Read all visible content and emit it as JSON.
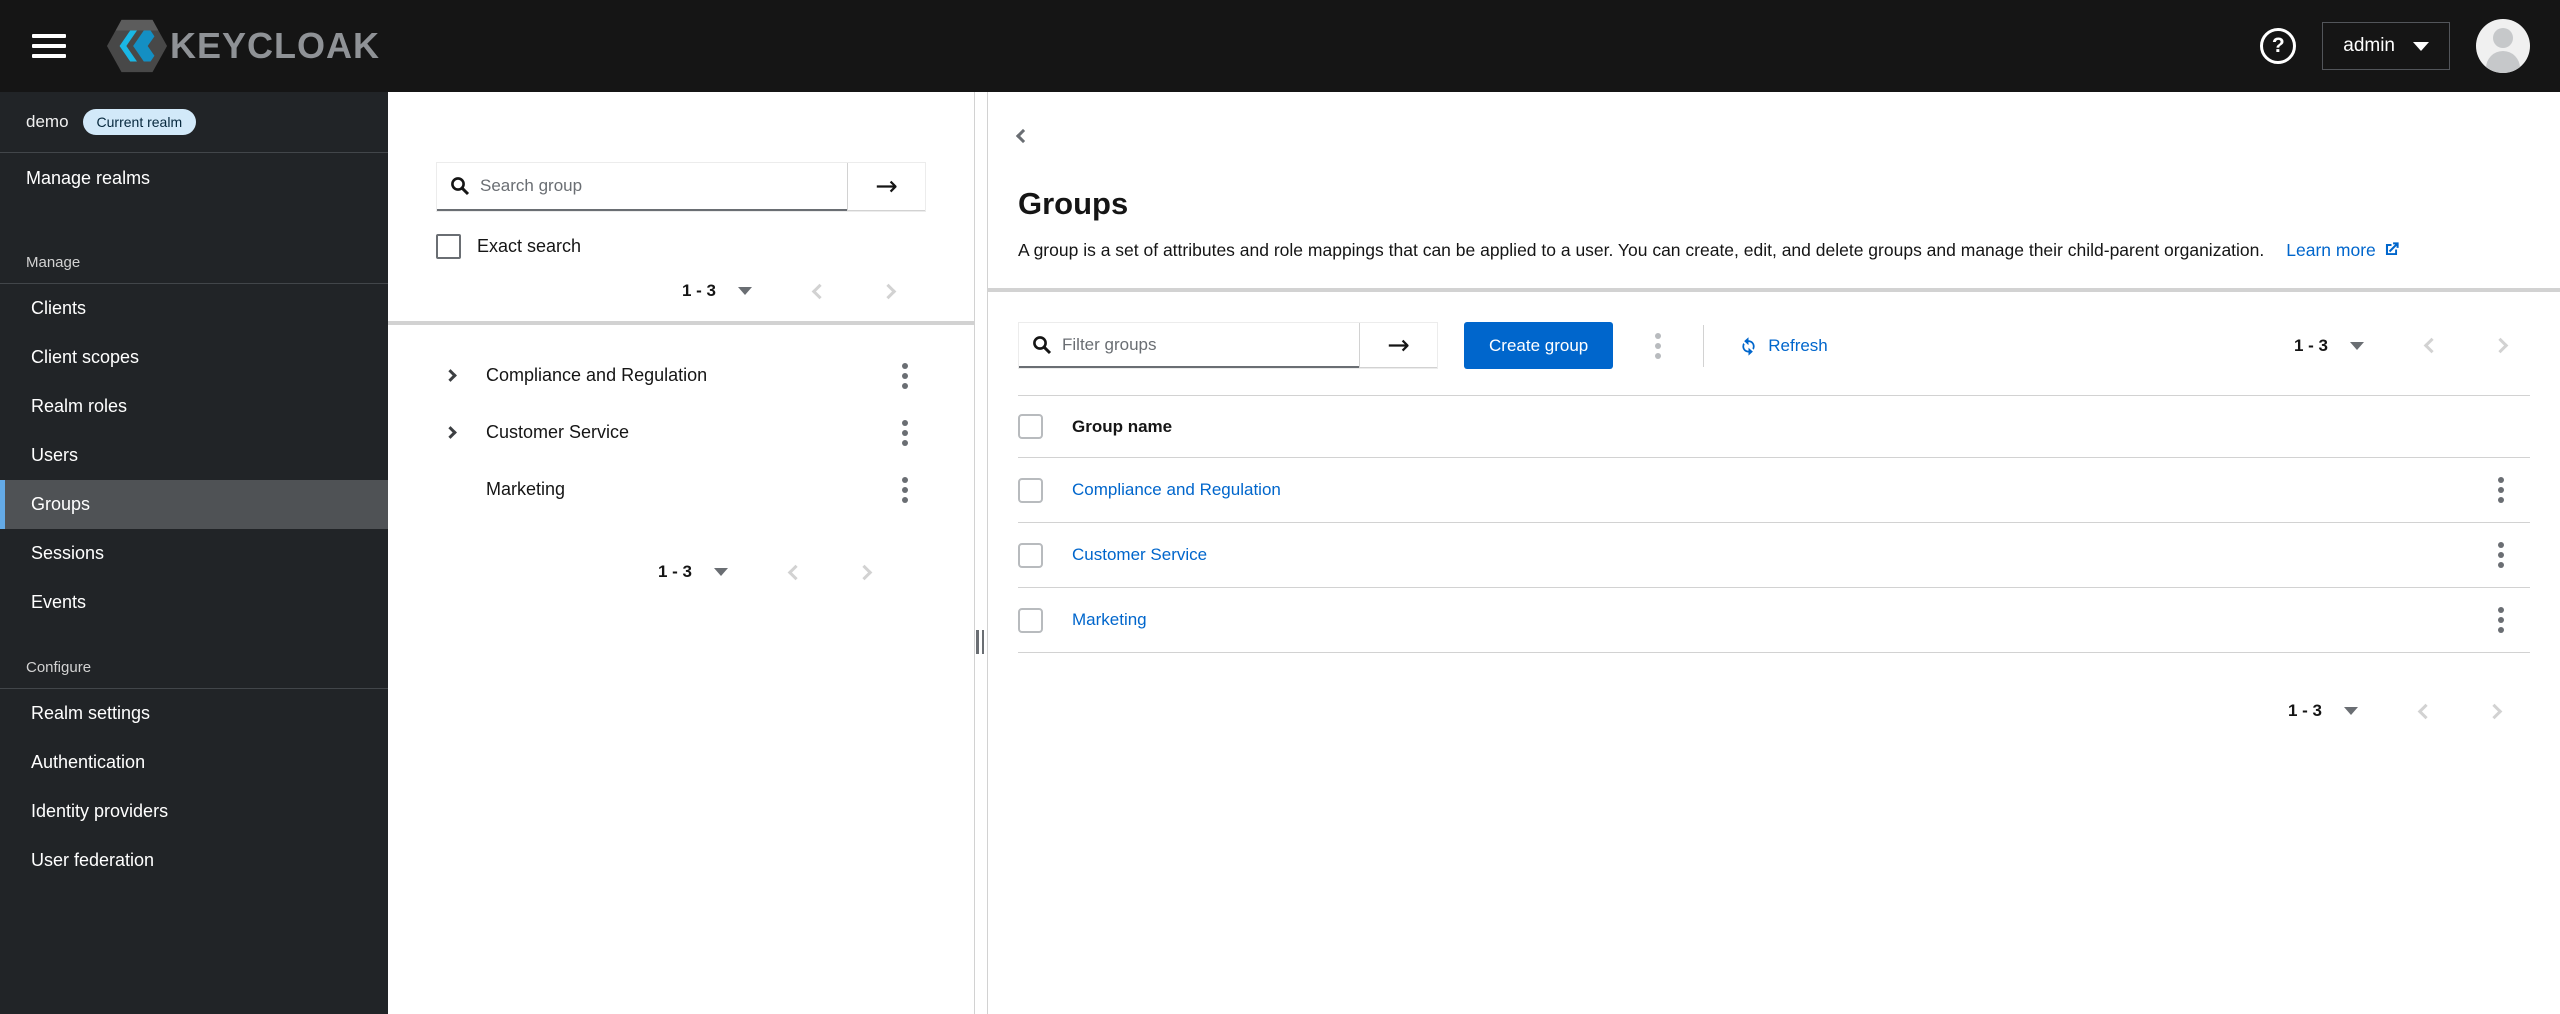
{
  "colors": {
    "accent": "#0066cc",
    "masthead_bg": "#151515",
    "sidebar_bg": "#212427",
    "nav_current_bg": "#4f5255",
    "nav_current_border": "#64aae6",
    "badge_bg": "#d2e9f9",
    "badge_text": "#06283d",
    "link": "#0066cc",
    "divider": "#d2d2d2"
  },
  "masthead": {
    "brand": "KEYCLOAK",
    "user": "admin"
  },
  "sidebar": {
    "realm_name": "demo",
    "realm_badge": "Current realm",
    "manage_realms": "Manage realms",
    "sections": [
      {
        "label": "Manage",
        "items": [
          {
            "label": "Clients",
            "current": false
          },
          {
            "label": "Client scopes",
            "current": false
          },
          {
            "label": "Realm roles",
            "current": false
          },
          {
            "label": "Users",
            "current": false
          },
          {
            "label": "Groups",
            "current": true
          },
          {
            "label": "Sessions",
            "current": false
          },
          {
            "label": "Events",
            "current": false
          }
        ]
      },
      {
        "label": "Configure",
        "items": [
          {
            "label": "Realm settings",
            "current": false
          },
          {
            "label": "Authentication",
            "current": false
          },
          {
            "label": "Identity providers",
            "current": false
          },
          {
            "label": "User federation",
            "current": false
          }
        ]
      }
    ]
  },
  "groups_panel": {
    "search_placeholder": "Search group",
    "exact_search_label": "Exact search",
    "pagination_top": "1 - 3",
    "pagination_bottom": "1 - 3",
    "tree": [
      {
        "label": "Compliance and Regulation",
        "expandable": true
      },
      {
        "label": "Customer Service",
        "expandable": true
      },
      {
        "label": "Marketing",
        "expandable": false
      }
    ]
  },
  "main": {
    "title": "Groups",
    "description": "A group is a set of attributes and role mappings that can be applied to a user. You can create, edit, and delete groups and manage their child-parent organization.",
    "learn_more": "Learn more",
    "toolbar": {
      "filter_placeholder": "Filter groups",
      "create_button": "Create group",
      "refresh": "Refresh",
      "pagination": "1 - 3"
    },
    "table": {
      "header": "Group name",
      "rows": [
        {
          "name": "Compliance and Regulation"
        },
        {
          "name": "Customer Service"
        },
        {
          "name": "Marketing"
        }
      ]
    },
    "pagination_bottom": "1 - 3"
  }
}
